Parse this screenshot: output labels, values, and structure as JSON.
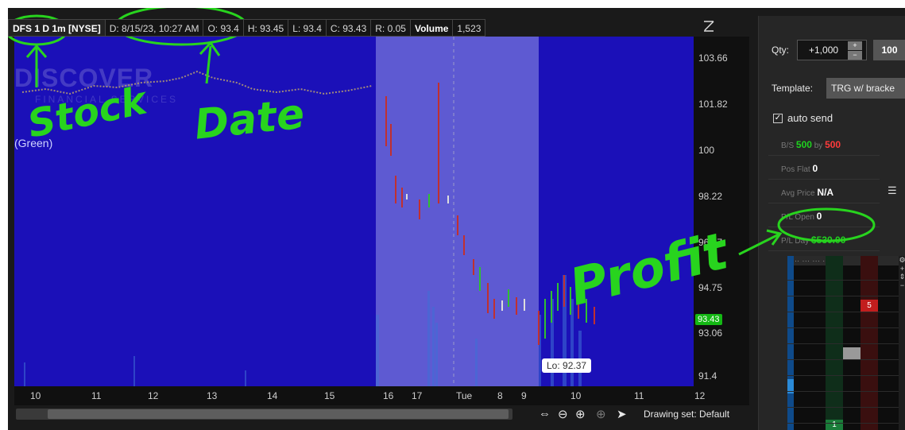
{
  "header": {
    "symbol": "DFS 1 D 1m [NYSE]",
    "date": "D: 8/15/23, 10:27 AM",
    "open": "O: 93.4",
    "high": "H: 93.45",
    "low": "L: 93.4",
    "close": "C: 93.43",
    "range": "R: 0.05",
    "volume_label": "Volume",
    "volume_value": "1,523"
  },
  "chart": {
    "watermark": "DISCOVER",
    "watermark_sub": "FINANCIAL SERVICES",
    "study_chip": "(Green)",
    "lo_label": "Lo: 92.37",
    "last_price": "93.43",
    "price_ticks": [
      "103.66",
      "101.82",
      "100",
      "98.22",
      "96.47",
      "94.75",
      "93.06",
      "91.4"
    ],
    "time_ticks": [
      "10",
      "11",
      "12",
      "13",
      "14",
      "15",
      "16",
      "17",
      "Tue",
      "8",
      "9",
      "10",
      "11",
      "12"
    ],
    "drawing_set": "Drawing set: Default"
  },
  "order_panel": {
    "qty_label": "Qty:",
    "qty_value": "+1,000",
    "qty_preset": "100",
    "template_label": "Template:",
    "template_value": "TRG w/ bracke",
    "auto_send_label": "auto send",
    "bs_label": "B/S",
    "bs_buy": "500",
    "bs_by": "by",
    "bs_sell": "500",
    "pos_flat_label": "Pos Flat",
    "pos_flat_value": "0",
    "avg_price_label": "Avg Price",
    "avg_price_value": "N/A",
    "pl_open_label": "P/L Open",
    "pl_open_value": "0",
    "pl_day_label": "P/L Day",
    "pl_day_value": "$530.00",
    "ladder_ask_size": "5",
    "ladder_bid_size": "1"
  },
  "annotations": {
    "stock": "Stock",
    "date": "Date",
    "profit": "Profit"
  },
  "colors": {
    "chart_bg": "#1b10b8",
    "session_shade": "#5e5ad2",
    "annotation": "#28d41e",
    "profit": "#1fd31f",
    "loss": "#ff3b3b"
  }
}
